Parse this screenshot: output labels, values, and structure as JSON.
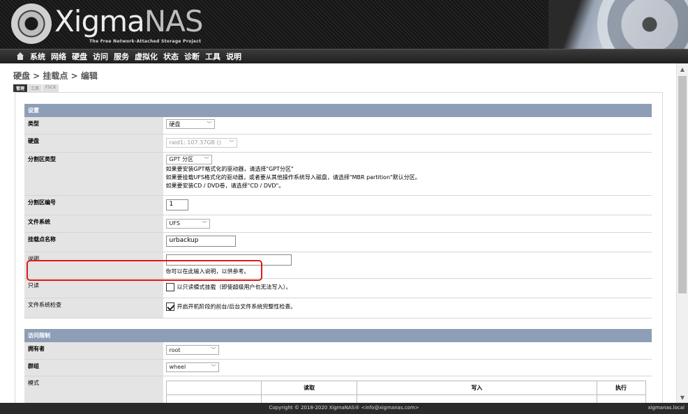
{
  "header": {
    "logo_main": "Xigma",
    "logo_accent": "NAS",
    "logo_subtitle": "The Free Network-Attached Storage Project"
  },
  "nav": [
    "系统",
    "网络",
    "硬盘",
    "访问",
    "服务",
    "虚拟化",
    "状态",
    "诊断",
    "工具",
    "说明"
  ],
  "breadcrumb": "硬盘 > 挂载点 > 编辑",
  "tabs": [
    "管理",
    "工具",
    "FSCK"
  ],
  "settings": {
    "section_title": "设置",
    "type": {
      "label": "类型",
      "value": "硬盘"
    },
    "disk": {
      "label": "硬盘",
      "value": "raid1: 107.37GB ()"
    },
    "partition_type": {
      "label": "分割区类型",
      "value": "GPT 分区",
      "help1": "如果要安装GPT格式化的驱动器，请选择\"GPT分区\"",
      "help2": "如果要挂载UFS格式化的驱动器，或者要从其他操作系统导入磁盘，请选择\"MBR partition\"默认分区。",
      "help3": "如果要安装CD / DVD卷，请选择\"CD / DVD\"。"
    },
    "partition_number": {
      "label": "分割区编号",
      "value": "1"
    },
    "filesystem": {
      "label": "文件系统",
      "value": "UFS"
    },
    "mount_name": {
      "label": "挂载点名称",
      "value": "urbackup"
    },
    "description": {
      "label": "说明",
      "value": "",
      "help": "你可以在此输入说明，以供参考。"
    },
    "readonly": {
      "label": "只读",
      "text": "以只读模式挂载（即使超级用户也无法写入）。",
      "checked": false
    },
    "fsck": {
      "label": "文件系统检查",
      "text": "开启开机阶段的前台/后台文件系统完整性检查。",
      "checked": true
    }
  },
  "access": {
    "section_title": "访问限制",
    "owner": {
      "label": "拥有者",
      "value": "root"
    },
    "group": {
      "label": "群组",
      "value": "wheel"
    },
    "mode": {
      "label": "模式",
      "headers": [
        "",
        "读取",
        "写入",
        "执行"
      ]
    }
  },
  "footer": {
    "copyright": "Copyright © 2018-2020 XigmaNAS® <info@xigmanas.com>",
    "hostname": "xigmanas.local"
  }
}
